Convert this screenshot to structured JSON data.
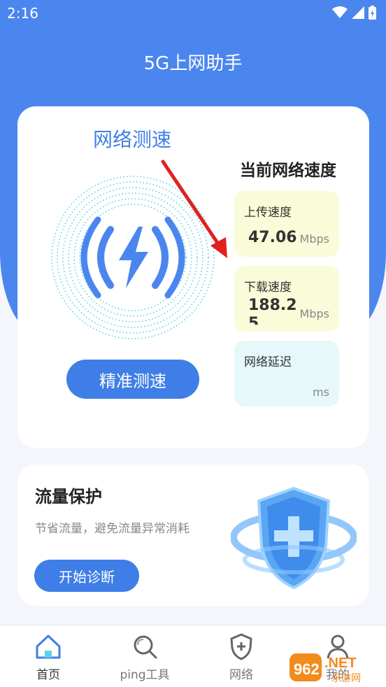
{
  "status_bar": {
    "time": "2:16"
  },
  "app": {
    "title": "5G上网助手"
  },
  "speed_card": {
    "heading": "网络测速",
    "button_label": "精准测速",
    "panel_title": "当前网络速度",
    "upload": {
      "label": "上传速度",
      "value": "47.06",
      "unit": "Mbps"
    },
    "download": {
      "label": "下载速度",
      "value": "188.25",
      "unit": "Mbps"
    },
    "latency": {
      "label": "网络延迟",
      "value": "",
      "unit": "ms"
    }
  },
  "protect_card": {
    "title": "流量保护",
    "description": "节省流量，避免流量异常消耗",
    "button_label": "开始诊断"
  },
  "tabs": [
    {
      "label": "首页",
      "icon": "home-icon",
      "active": true
    },
    {
      "label": "ping工具",
      "icon": "magnifier-icon",
      "active": false
    },
    {
      "label": "网络",
      "icon": "shield-plus-icon",
      "active": false
    },
    {
      "label": "我的",
      "icon": "person-icon",
      "active": false
    }
  ],
  "watermark": {
    "text": "962.NET",
    "subtext": "乐游网"
  },
  "colors": {
    "primary": "#4a86ee",
    "button": "#3f7ee6",
    "upload_bg": "#fafcd9",
    "latency_bg": "#e6f8fa",
    "arrow": "#e02020"
  }
}
